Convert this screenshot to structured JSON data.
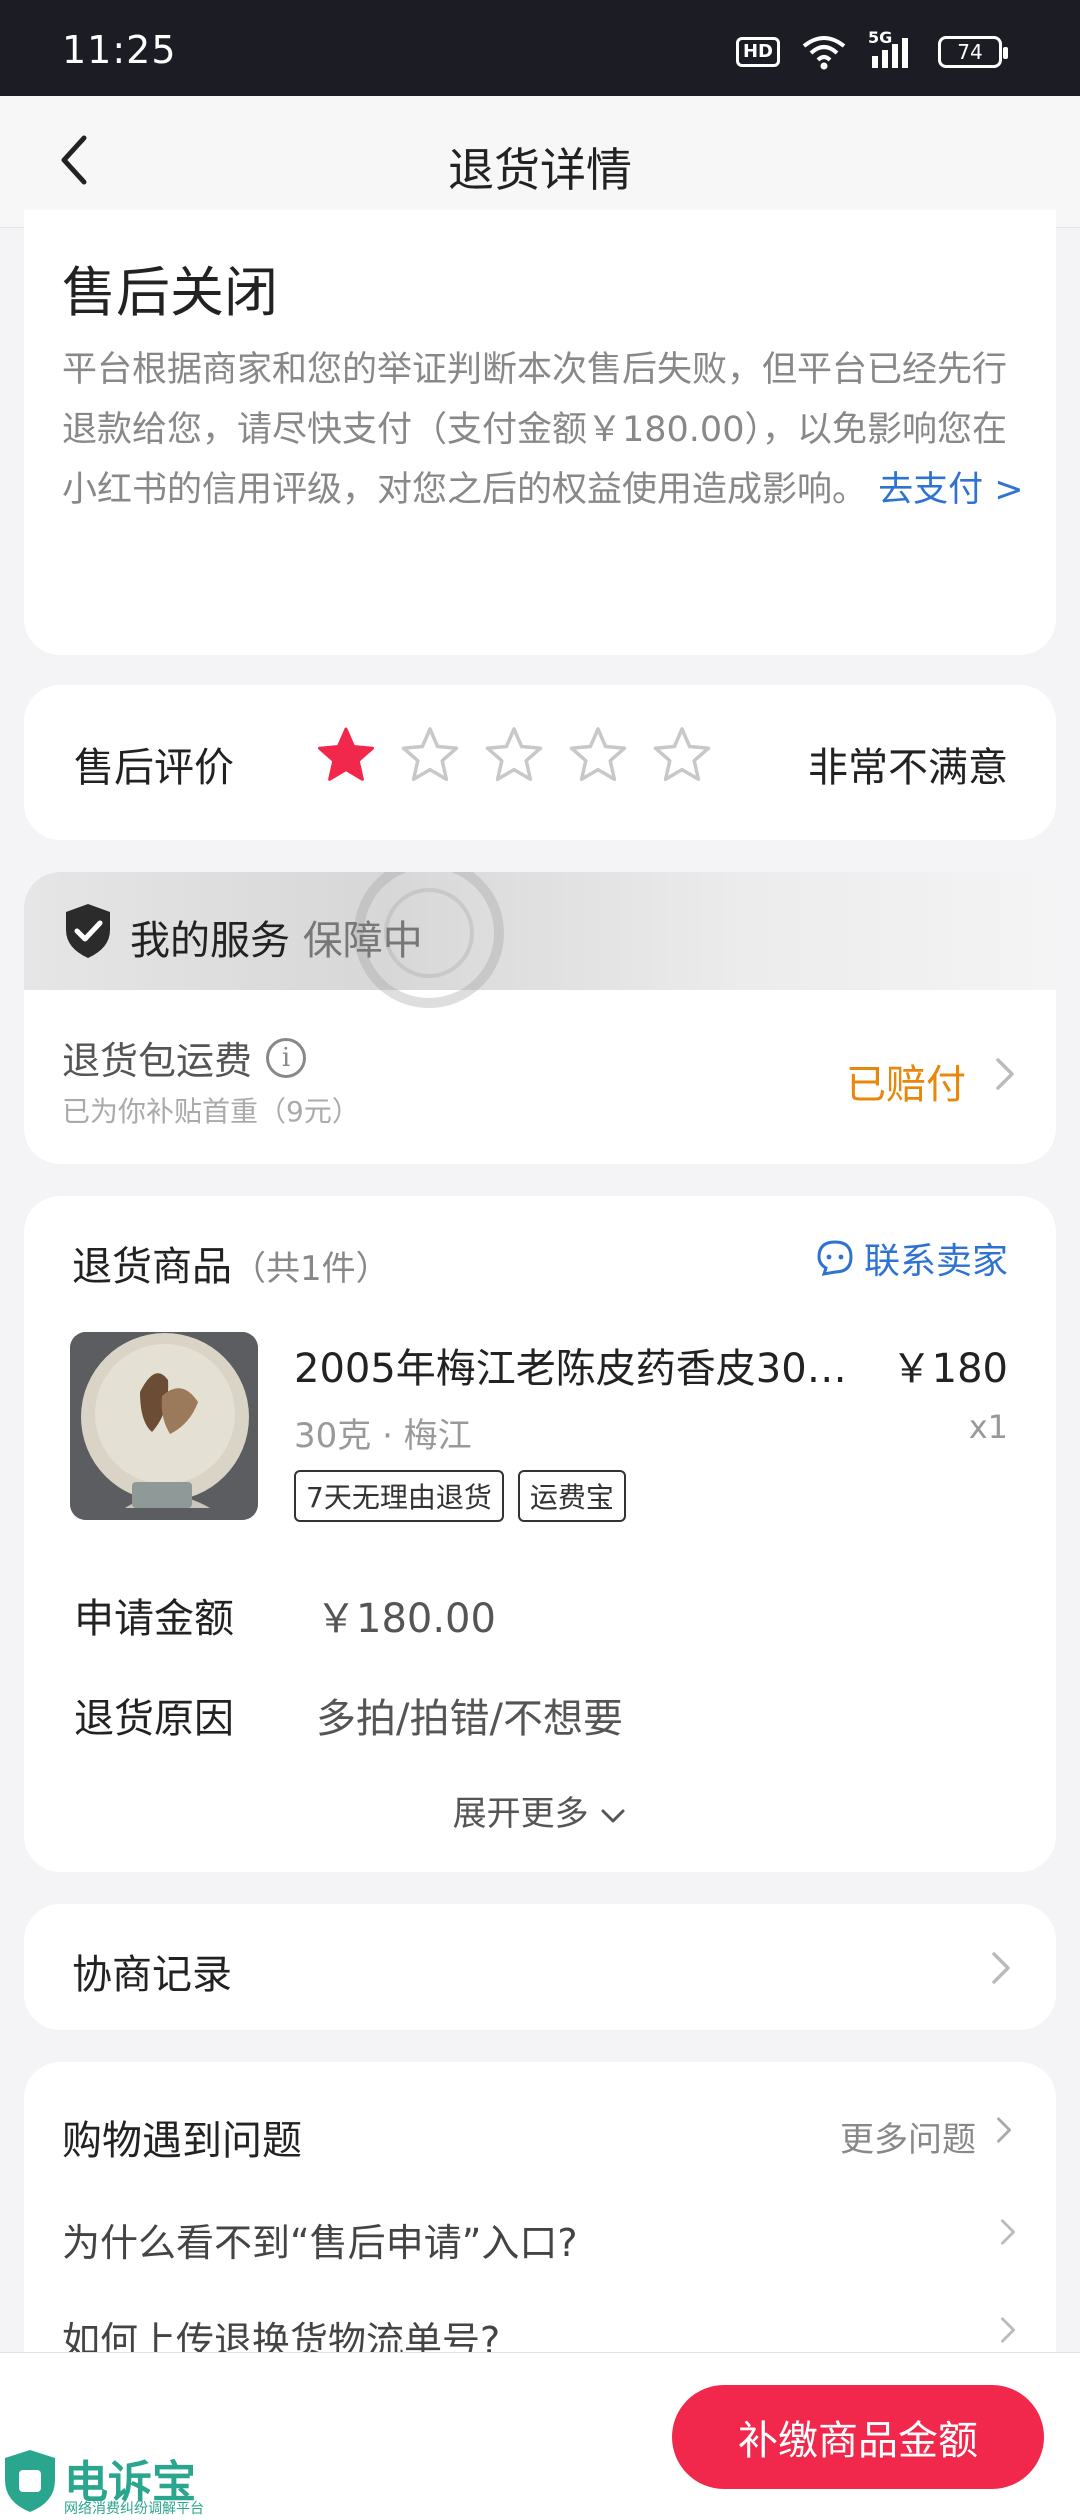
{
  "status_bar": {
    "time": "11:25",
    "hd_label": "HD",
    "network_label": "5G",
    "battery": "74"
  },
  "header": {
    "title": "退货详情",
    "back_icon": "chevron-left-icon"
  },
  "status_card": {
    "title": "售后关闭",
    "description": "平台根据商家和您的举证判断本次售后失败，但平台已经先行退款给您，请尽快支付（支付金额￥180.00），以免影响您在小红书的信用评级，对您之后的权益使用造成影响。",
    "link": "去支付 >",
    "link_color": "#2e72d2"
  },
  "rating_card": {
    "label": "售后评价",
    "rating": 1,
    "max_rating": 5,
    "rating_text": "非常不满意",
    "star_color": "#f2274c"
  },
  "service_card": {
    "title": "我的服务",
    "title_sub": "保障中",
    "shipping_label": "退货包运费",
    "shipping_sub": "已为你补贴首重（9元）",
    "shipping_status": "已赔付",
    "status_color": "#e8870b"
  },
  "goods_card": {
    "header": "退货商品",
    "count": "（共1件）",
    "contact_label": "联系卖家",
    "product": {
      "name": "2005年梅江老陈皮药香皮30…",
      "price": "￥180",
      "spec": "30克 · 梅江",
      "qty": "x1",
      "tags": [
        "7天无理由退货",
        "运费宝"
      ]
    },
    "apply_amount_label": "申请金额",
    "apply_amount_value": "￥180.00",
    "reason_label": "退货原因",
    "reason_value": "多拍/拍错/不想要",
    "expand_label": "展开更多"
  },
  "negotiation": {
    "label": "协商记录"
  },
  "faq": {
    "title": "购物遇到问题",
    "more": "更多问题",
    "items": [
      "为什么看不到“售后申请”入口?",
      "如何上传退换货物流单号?"
    ]
  },
  "bottom_bar": {
    "button_label": "补缴商品金额",
    "button_color": "#f2274c"
  },
  "watermark": {
    "title": "电诉宝",
    "subtitle": "网络消费纠纷调解平台"
  }
}
